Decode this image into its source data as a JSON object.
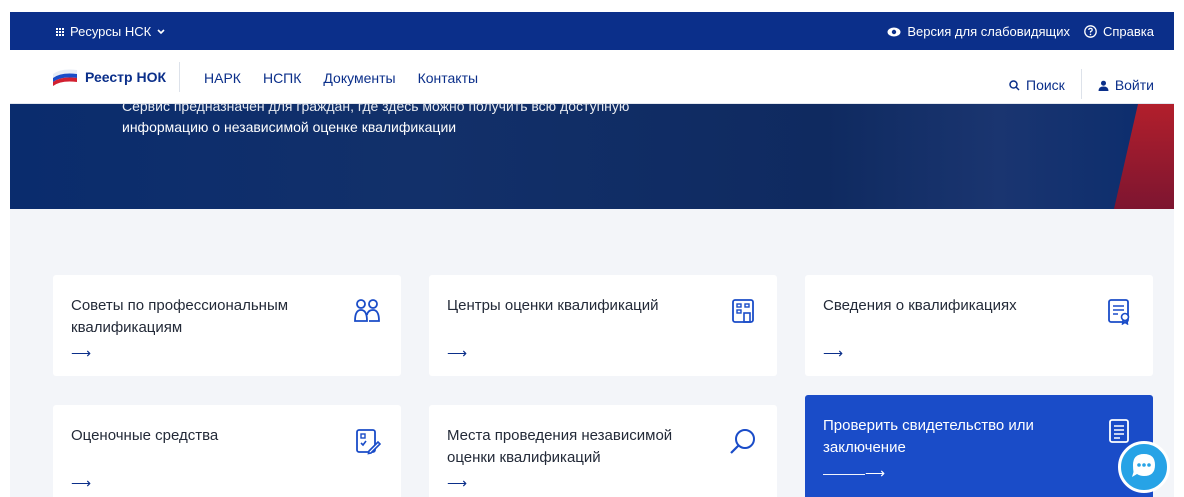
{
  "topbar": {
    "resources_label": "Ресурсы НСК",
    "accessibility_label": "Версия для слабовидящих",
    "help_label": "Справка"
  },
  "navbar": {
    "logo_text": "Реестр НОК",
    "links": [
      "НАРК",
      "НСПК",
      "Документы",
      "Контакты"
    ],
    "search_label": "Поиск",
    "login_label": "Войти"
  },
  "hero": {
    "text_line_cut": "Сервис предназначен для граждан, где здесь можно получить всю доступную",
    "text_line": "информацию о независимой оценке квалификации"
  },
  "cards": [
    {
      "title": "Советы по профессиональным квалификациям",
      "icon": "people-icon",
      "arrow": "⟶"
    },
    {
      "title": "Центры оценки квалификаций",
      "icon": "building-icon",
      "arrow": "⟶"
    },
    {
      "title": "Сведения о квалификациях",
      "icon": "certificate-icon",
      "arrow": "⟶"
    },
    {
      "title": "Оценочные средства",
      "icon": "edit-document-icon",
      "arrow": "⟶"
    },
    {
      "title": "Места проведения независимой оценки квалификаций",
      "icon": "search-icon",
      "arrow": "⟶"
    },
    {
      "title": "Проверить свидетельство или заключение",
      "icon": "document-icon",
      "arrow": "———⟶"
    }
  ],
  "colors": {
    "brand": "#0b2f8a",
    "hero": "#0a2c6d",
    "active_card": "#1a4cc8",
    "chat": "#27a3e6"
  }
}
